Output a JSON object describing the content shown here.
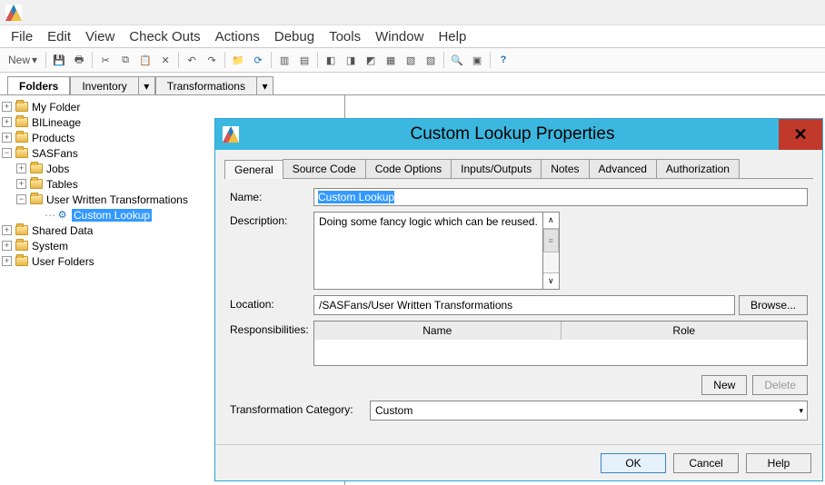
{
  "menus": [
    "File",
    "Edit",
    "View",
    "Check Outs",
    "Actions",
    "Debug",
    "Tools",
    "Window",
    "Help"
  ],
  "toolbar": {
    "new_label": "New"
  },
  "left_tabs": {
    "folders": "Folders",
    "inventory": "Inventory",
    "transformations": "Transformations"
  },
  "tree": {
    "myfolder": "My Folder",
    "bilineage": "BILineage",
    "products": "Products",
    "sasfans": "SASFans",
    "jobs": "Jobs",
    "tables": "Tables",
    "uwt": "User Written Transformations",
    "custom_lookup": "Custom Lookup",
    "shared": "Shared Data",
    "system": "System",
    "userfolders": "User Folders"
  },
  "dialog": {
    "title": "Custom Lookup Properties",
    "tabs": [
      "General",
      "Source Code",
      "Code Options",
      "Inputs/Outputs",
      "Notes",
      "Advanced",
      "Authorization"
    ],
    "labels": {
      "name": "Name:",
      "description": "Description:",
      "location": "Location:",
      "responsibilities": "Responsibilities:",
      "category": "Transformation Category:"
    },
    "name_value": "Custom Lookup",
    "description_value": "Doing some fancy logic which can be reused.",
    "location_value": "/SASFans/User Written Transformations",
    "browse": "Browse...",
    "col_name": "Name",
    "col_role": "Role",
    "btn_new": "New",
    "btn_delete": "Delete",
    "category_value": "Custom",
    "ok": "OK",
    "cancel": "Cancel",
    "help": "Help"
  }
}
